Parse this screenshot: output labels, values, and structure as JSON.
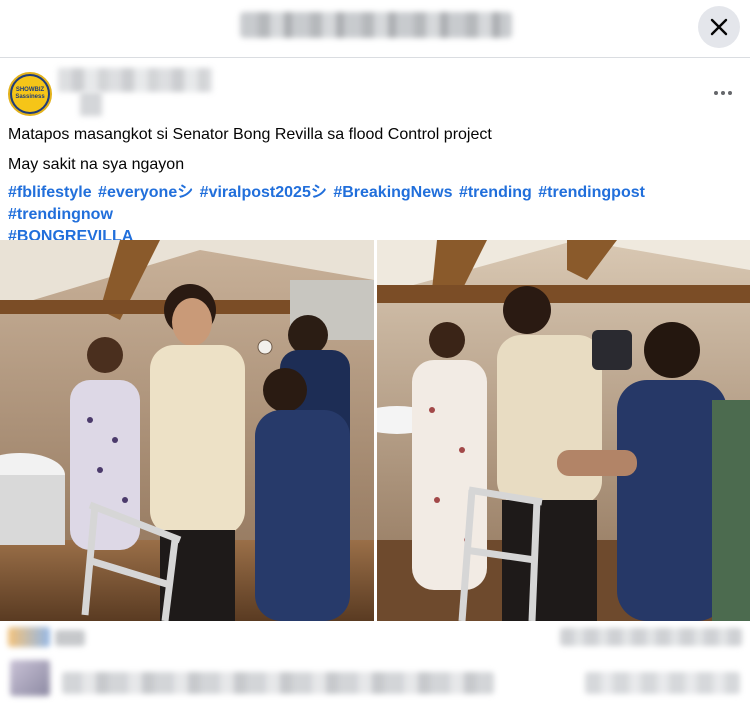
{
  "header": {
    "close_icon": "close-icon"
  },
  "post": {
    "avatar_text": [
      "SHOWBIZ",
      "Sassiness"
    ],
    "more_icon": "more-horizontal-icon",
    "caption_line_1": "Matapos masangkot si Senator Bong Revilla sa flood Control project",
    "caption_line_2": "May sakit na sya ngayon",
    "hashtags": [
      "#fblifestyle",
      "#everyoneシ",
      "#viralpost2025シ",
      "#BreakingNews",
      "#trending",
      "#trendingpost",
      "#trendingnow",
      "#BONGREVILLA"
    ]
  },
  "colors": {
    "hashtag": "#216fdb",
    "close_button_bg": "#e4e6eb",
    "avatar_gold": "#f5c518",
    "avatar_navy": "#1f3c7a"
  }
}
